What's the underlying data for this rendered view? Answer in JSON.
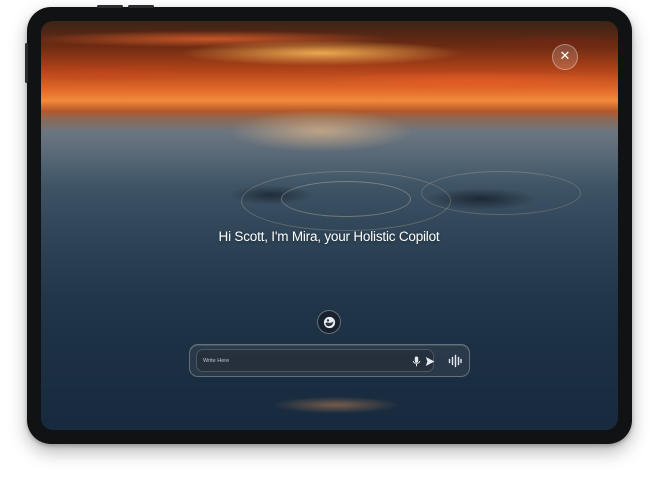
{
  "device": {
    "kind": "tablet"
  },
  "screen": {
    "close_icon": "close-icon",
    "greeting": "Hi Scott, I'm Mira, your Holistic Copilot",
    "assistant_icon": "assistant-orb-icon",
    "composer": {
      "placeholder": "Write Here",
      "value": "",
      "mic_icon": "microphone-icon",
      "send_icon": "send-icon",
      "voice_icon": "voice-waveform-icon"
    }
  },
  "colors": {
    "sunset_orange": "#e46b2a",
    "sea_dark": "#1c3044",
    "text": "#ffffff"
  }
}
